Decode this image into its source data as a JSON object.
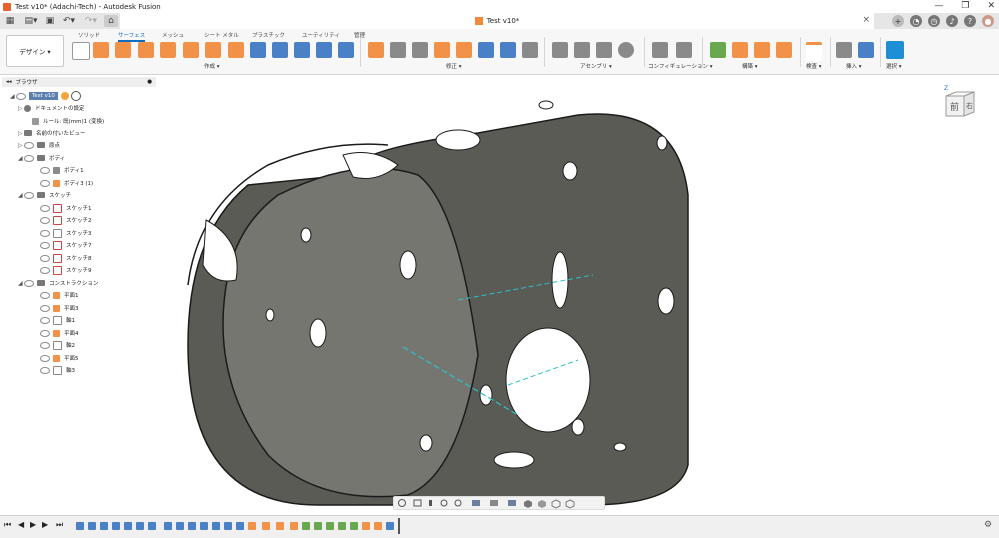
{
  "window": {
    "title": "Test v10* (Adachi-Tech) - Autodesk Fusion",
    "controls": [
      "—",
      "❐",
      "✕"
    ]
  },
  "quick_access": {
    "items": [
      "grid-icon",
      "file-menu-icon",
      "save-icon",
      "undo-icon",
      "redo-icon",
      "home-icon"
    ]
  },
  "document_tab": {
    "label": "Test v10*",
    "close": "×"
  },
  "right_tools": {
    "icons": [
      "add-tab-icon",
      "online-icon",
      "jobs-icon",
      "notifications-icon",
      "help-icon",
      "profile-icon"
    ]
  },
  "workspace": {
    "label": "デザイン ▾"
  },
  "tabs": [
    {
      "label": "ソリッド",
      "active": false
    },
    {
      "label": "サーフェス",
      "active": true
    },
    {
      "label": "メッシュ",
      "active": false
    },
    {
      "label": "シート メタル",
      "active": false
    },
    {
      "label": "プラスチック",
      "active": false
    },
    {
      "label": "ユーティリティ",
      "active": false
    },
    {
      "label": "管理",
      "active": false
    }
  ],
  "groups": [
    {
      "label": "作成 ▾"
    },
    {
      "label": "修正 ▾"
    },
    {
      "label": "アセンブリ ▾"
    },
    {
      "label": "コンフィギュレーション ▾"
    },
    {
      "label": "構築 ▾"
    },
    {
      "label": "検査 ▾"
    },
    {
      "label": "挿入 ▾"
    },
    {
      "label": "選択 ▾"
    }
  ],
  "browser": {
    "header": "ブラウザ",
    "root": "Test v10",
    "items": [
      {
        "label": "ドキュメントの設定",
        "level": 1
      },
      {
        "label": "ルール: 既(mm)1 (変換)",
        "level": 2
      },
      {
        "label": "名前の付いたビュー",
        "level": 1
      },
      {
        "label": "原点",
        "level": 1
      },
      {
        "label": "ボディ",
        "level": 1
      },
      {
        "label": "ボディ1",
        "level": 2
      },
      {
        "label": "ボディ3 (1)",
        "level": 2
      },
      {
        "label": "スケッチ",
        "level": 1
      },
      {
        "label": "スケッチ1",
        "level": 2
      },
      {
        "label": "スケッチ2",
        "level": 2
      },
      {
        "label": "スケッチ3",
        "level": 2
      },
      {
        "label": "スケッチ7",
        "level": 2
      },
      {
        "label": "スケッチ8",
        "level": 2
      },
      {
        "label": "スケッチ9",
        "level": 2
      },
      {
        "label": "コンストラクション",
        "level": 1
      },
      {
        "label": "平面1",
        "level": 2
      },
      {
        "label": "平面3",
        "level": 2
      },
      {
        "label": "軸1",
        "level": 2
      },
      {
        "label": "平面4",
        "level": 2
      },
      {
        "label": "軸2",
        "level": 2
      },
      {
        "label": "平面5",
        "level": 2
      },
      {
        "label": "軸3",
        "level": 2
      }
    ]
  },
  "viewcube": {
    "front": "前",
    "right": "右",
    "axis": "Z"
  },
  "colors": {
    "accent": "#0f6dbf",
    "orange": "#f29148",
    "model_body": "#5b5b55",
    "axis_line": "#2bc0c7"
  }
}
